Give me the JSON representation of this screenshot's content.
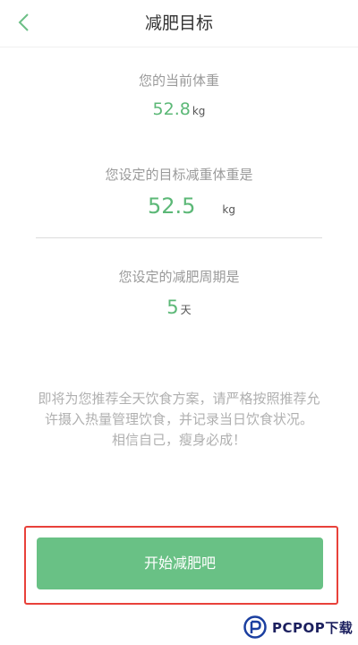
{
  "header": {
    "title": "减肥目标",
    "back_icon": "chevron-left-icon"
  },
  "current_weight": {
    "label": "您的当前体重",
    "value": "52.8",
    "unit": "kg"
  },
  "target_weight": {
    "label": "您设定的目标减重体重是",
    "value": "52.5",
    "unit": "kg"
  },
  "period": {
    "label": "您设定的减肥周期是",
    "value": "5",
    "unit": "天"
  },
  "notice": {
    "line1": "即将为您推荐全天饮食方案，请严格按照推荐允",
    "line2": "许摄入热量管理饮食，并记录当日饮食状况。",
    "line3": "相信自己，瘦身必成！"
  },
  "start_button": {
    "label": "开始减肥吧"
  },
  "watermark": {
    "text": "PCPOP下载"
  },
  "colors": {
    "accent_green": "#5cb877",
    "button_green": "#69c185",
    "highlight_red": "#e8413a"
  }
}
